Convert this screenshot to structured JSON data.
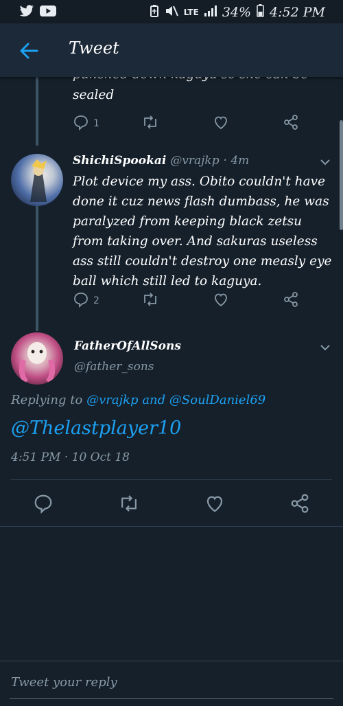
{
  "status": {
    "network": "LTE",
    "battery": "34%",
    "time": "4:52 PM"
  },
  "header": {
    "title": "Tweet"
  },
  "partial_tweet": {
    "text_clipped": "punched down kaguya so she can be",
    "text_last": "sealed",
    "reply_count": "1"
  },
  "tweet_reply": {
    "name": "ShichiSpookai",
    "handle": "@vrajkp",
    "time": "· 4m",
    "lines": [
      "Plot device my ass. Obito couldn't have",
      "done it cuz news flash dumbass, he was",
      "paralyzed from keeping black zetsu",
      "from taking over. And sakuras useless",
      "ass still couldn't destroy one measly eye",
      "ball which still led to kaguya."
    ],
    "reply_count": "2"
  },
  "main_tweet": {
    "name": "FatherOfAllSons",
    "handle": "@father_sons",
    "replying_prefix": "Replying to",
    "replying_user1": "@vrajkp",
    "replying_and": "and",
    "replying_user2": "@SoulDaniel69",
    "text": "@Thelastplayer10",
    "timestamp": "4:51 PM · 10 Oct 18"
  },
  "reply_field": {
    "placeholder": "Tweet your reply"
  },
  "colors": {
    "accent": "#1da1f2",
    "background": "#15202b",
    "muted": "#8899a6"
  }
}
